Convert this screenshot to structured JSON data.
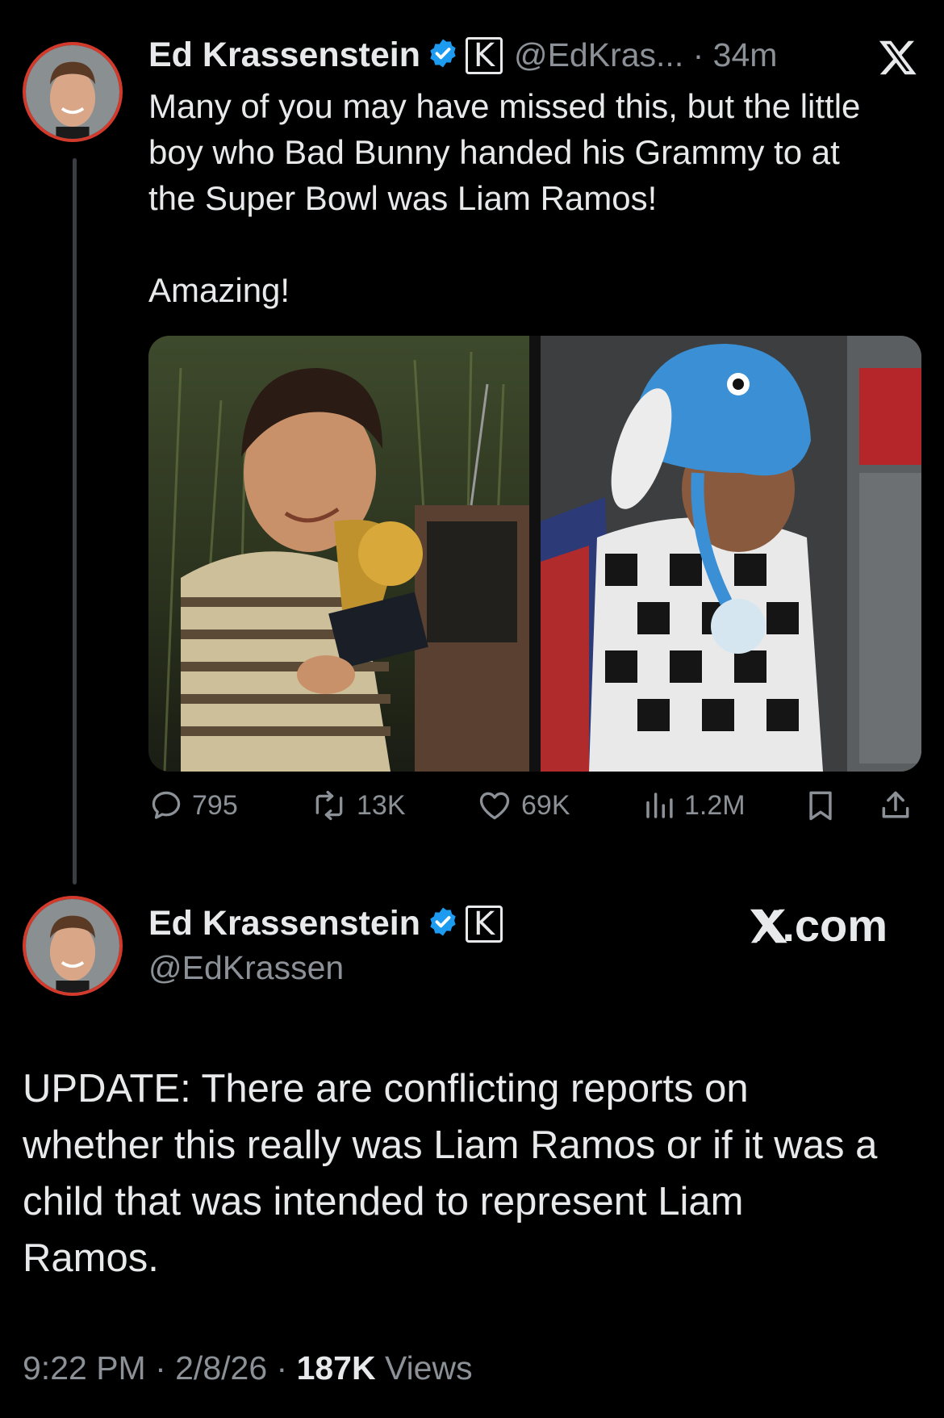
{
  "first_post": {
    "author_name": "Ed Krassenstein",
    "handle_time": "@EdKras... · 34m",
    "text_lines": [
      "Many of you may have missed this, but the little",
      "boy who Bad Bunny handed his Grammy to at",
      "the Super Bowl was Liam Ramos!"
    ],
    "text_extra": "Amazing!",
    "actions": {
      "replies": "795",
      "reposts": "13K",
      "likes": "69K",
      "views": "1.2M"
    }
  },
  "second_post": {
    "author_name": "Ed Krassenstein",
    "handle": "@EdKrassen",
    "site_label": "X.com",
    "text_lines": [
      "UPDATE: There are conflicting reports on",
      "whether this really was Liam Ramos or if it was a",
      "child that was intended to represent Liam",
      "Ramos."
    ],
    "time_date": "9:22 PM · 2/8/26 · ",
    "views_count": "187K",
    "views_label": " Views"
  },
  "icons": {
    "verified": "verified-badge-icon",
    "k_badge": "k-affiliate-badge-icon",
    "x_logo": "x-logo-icon"
  },
  "colors": {
    "background": "#000000",
    "primary_text": "#e7e9ea",
    "secondary_text": "#8b9197",
    "verified_blue": "#1d9bf0",
    "avatar_ring": "#d23a2c"
  }
}
